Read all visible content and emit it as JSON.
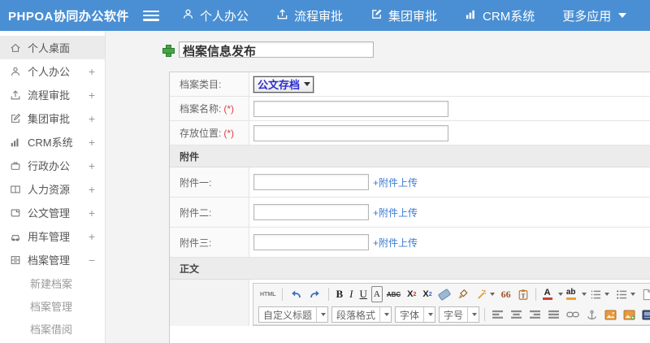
{
  "topbar": {
    "logo": "PHPOA协同办公软件",
    "nav": [
      {
        "label": "个人办公",
        "icon": "person-icon"
      },
      {
        "label": "流程审批",
        "icon": "workflow-icon"
      },
      {
        "label": "集团审批",
        "icon": "edit-square-icon"
      },
      {
        "label": "CRM系统",
        "icon": "bar-chart-icon"
      },
      {
        "label": "更多应用",
        "icon": "caret-down-icon"
      }
    ]
  },
  "sidebar": {
    "items": [
      {
        "label": "个人桌面",
        "expand": ""
      },
      {
        "label": "个人办公",
        "expand": "+"
      },
      {
        "label": "流程审批",
        "expand": "+"
      },
      {
        "label": "集团审批",
        "expand": "+"
      },
      {
        "label": "CRM系统",
        "expand": "+"
      },
      {
        "label": "行政办公",
        "expand": "+"
      },
      {
        "label": "人力资源",
        "expand": "+"
      },
      {
        "label": "公文管理",
        "expand": "+"
      },
      {
        "label": "用车管理",
        "expand": "+"
      },
      {
        "label": "档案管理",
        "expand": "−"
      }
    ],
    "subitems": [
      {
        "label": "新建档案"
      },
      {
        "label": "档案管理"
      },
      {
        "label": "档案借阅"
      }
    ]
  },
  "main": {
    "page_title": "档案信息发布",
    "form": {
      "category_label": "档案类目:",
      "category_value": "公文存档",
      "name_label": "档案名称:",
      "location_label": "存放位置:",
      "required": "(*)",
      "attach_header": "附件",
      "attach_rows": [
        {
          "label": "附件一:",
          "link": "+附件上传"
        },
        {
          "label": "附件二:",
          "link": "+附件上传"
        },
        {
          "label": "附件三:",
          "link": "+附件上传"
        }
      ],
      "body_header": "正文"
    }
  },
  "editor": {
    "icons": {
      "html": "HTML",
      "bold": "B",
      "italic": "I",
      "underline": "U",
      "font_box": "A",
      "strike": "ABC",
      "sup_base": "X",
      "sup_mark": "2",
      "sub_base": "X",
      "sub_mark": "2",
      "quote": "66",
      "forecolor": "A",
      "backcolor": "ab"
    },
    "selects": {
      "style": "自定义标题",
      "paragraph": "段落格式",
      "font": "字体",
      "size": "字号"
    }
  },
  "colors": {
    "topbar_blue": "#4a8fd3",
    "link_blue": "#3a7bd5",
    "select_text_blue": "#2b2bcc",
    "required_red": "#e04040",
    "plus_green": "#46a546"
  }
}
